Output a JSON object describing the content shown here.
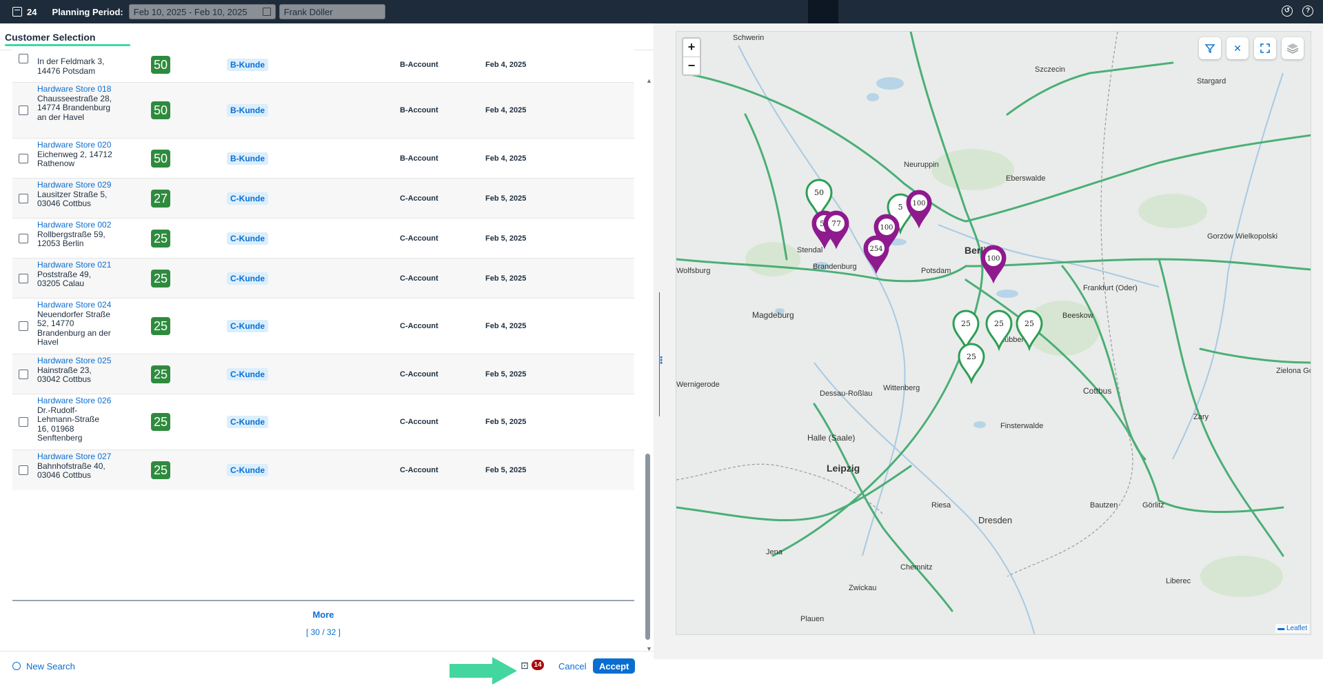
{
  "shellbar": {
    "count": "24",
    "planning_label": "Planning Period:",
    "date_range": "Feb 10, 2025 - Feb 10, 2025",
    "user": "Frank Döller"
  },
  "panel_title": "Customer Selection",
  "rows": [
    {
      "name": "",
      "address": "In der Feldmark 3, 14476 Potsdam",
      "score": "50",
      "tag": "B-Kunde",
      "account": "B-Account",
      "date": "Feb 4, 2025"
    },
    {
      "name": "Hardware Store 018",
      "address": "Chausseestraße 28, 14774 Brandenburg an der Havel",
      "score": "50",
      "tag": "B-Kunde",
      "account": "B-Account",
      "date": "Feb 4, 2025"
    },
    {
      "name": "Hardware Store 020",
      "address": "Eichenweg 2, 14712 Rathenow",
      "score": "50",
      "tag": "B-Kunde",
      "account": "B-Account",
      "date": "Feb 4, 2025"
    },
    {
      "name": "Hardware Store 029",
      "address": "Lausitzer Straße 5, 03046 Cottbus",
      "score": "27",
      "tag": "C-Kunde",
      "account": "C-Account",
      "date": "Feb 5, 2025"
    },
    {
      "name": "Hardware Store 002",
      "address": "Rollbergstraße 59, 12053 Berlin",
      "score": "25",
      "tag": "C-Kunde",
      "account": "C-Account",
      "date": "Feb 5, 2025"
    },
    {
      "name": "Hardware Store 021",
      "address": "Poststraße 49, 03205 Calau",
      "score": "25",
      "tag": "C-Kunde",
      "account": "C-Account",
      "date": "Feb 5, 2025"
    },
    {
      "name": "Hardware Store 024",
      "address": "Neuendorfer Straße 52, 14770 Brandenburg an der Havel",
      "score": "25",
      "tag": "C-Kunde",
      "account": "C-Account",
      "date": "Feb 4, 2025"
    },
    {
      "name": "Hardware Store 025",
      "address": "Hainstraße 23, 03042 Cottbus",
      "score": "25",
      "tag": "C-Kunde",
      "account": "C-Account",
      "date": "Feb 5, 2025"
    },
    {
      "name": "Hardware Store 026",
      "address": "Dr.-Rudolf-Lehmann-Straße 16, 01968 Senftenberg",
      "score": "25",
      "tag": "C-Kunde",
      "account": "C-Account",
      "date": "Feb 5, 2025"
    },
    {
      "name": "Hardware Store 027",
      "address": "Bahnhofstraße 40, 03046 Cottbus",
      "score": "25",
      "tag": "C-Kunde",
      "account": "C-Account",
      "date": "Feb 5, 2025"
    }
  ],
  "more": {
    "label": "More",
    "count": "[ 30 / 32 ]"
  },
  "footer": {
    "new_search": "New Search",
    "basket_count": "14",
    "cancel": "Cancel",
    "accept": "Accept"
  },
  "map": {
    "zoom_in": "+",
    "zoom_out": "−",
    "attribution": "Leaflet",
    "cities": [
      "Schwerin",
      "Szczecin",
      "Stargard",
      "Neuruppin",
      "Eberswalde",
      "Berlin",
      "Potsdam",
      "Brandenburg",
      "Magdeburg",
      "Frankfurt (Oder)",
      "Beeskow",
      "Cottbus",
      "Halle (Saale)",
      "Leipzig",
      "Dresden",
      "Chemnitz",
      "Wittenberg",
      "Dessau-Roßlau",
      "Gorzów Wielkopolski",
      "Zielona Góra",
      "Wolfsburg",
      "Liberec",
      "Jena",
      "Zwickau",
      "Stendal",
      "Wernigerode",
      "Lübben",
      "Finsterwalde",
      "Riesa",
      "Görlitz",
      "Bautzen",
      "Żary",
      "Plauen"
    ],
    "markers": [
      {
        "label": "50",
        "color": "#2e9e55"
      },
      {
        "label": "51",
        "color": "#8e1a8e"
      },
      {
        "label": "77",
        "color": "#8e1a8e"
      },
      {
        "label": "5",
        "color": "#2e9e55"
      },
      {
        "label": "100",
        "color": "#8e1a8e"
      },
      {
        "label": "100",
        "color": "#8e1a8e"
      },
      {
        "label": "254",
        "color": "#8e1a8e"
      },
      {
        "label": "100",
        "color": "#8e1a8e"
      },
      {
        "label": "25",
        "color": "#2e9e55"
      },
      {
        "label": "25",
        "color": "#2e9e55"
      },
      {
        "label": "25",
        "color": "#2e9e55"
      },
      {
        "label": "25",
        "color": "#2e9e55"
      }
    ]
  }
}
